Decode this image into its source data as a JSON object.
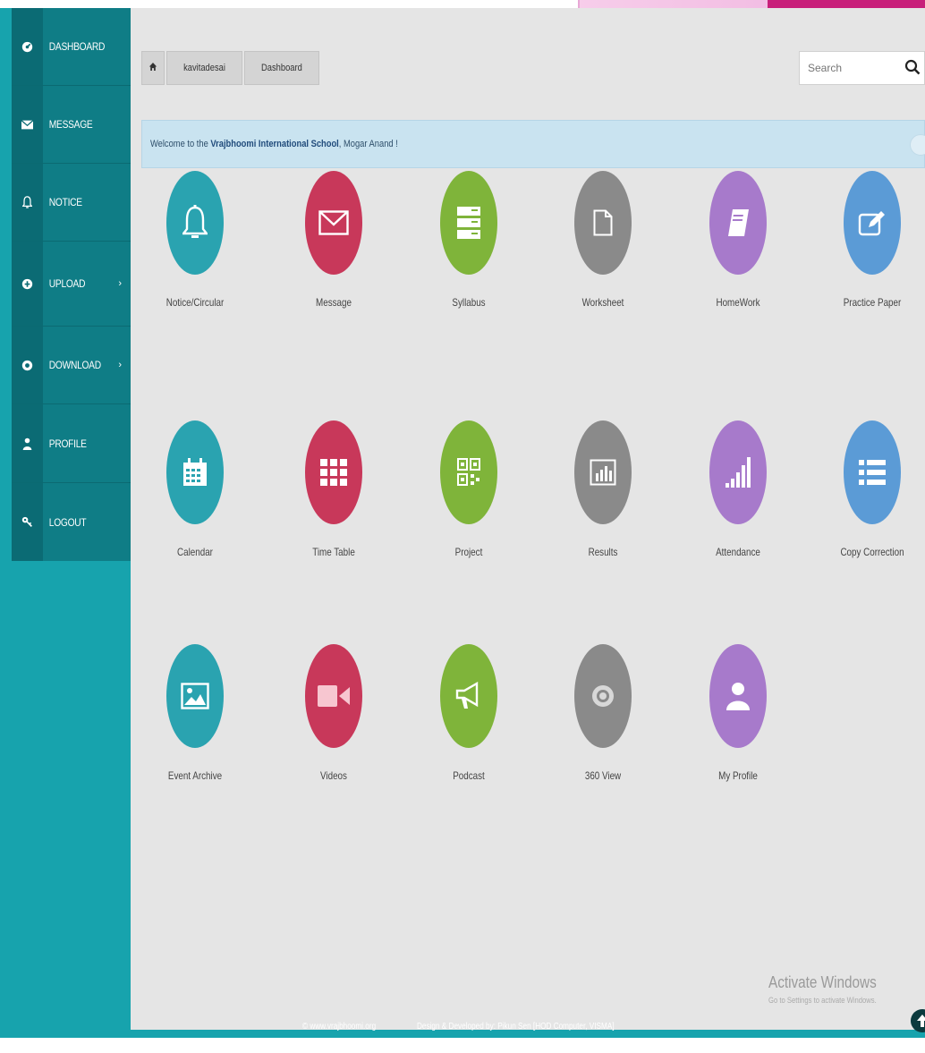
{
  "sidebar": {
    "items": [
      {
        "label": "DASHBOARD",
        "icon": "dashboard-icon"
      },
      {
        "label": "MESSAGE",
        "icon": "envelope-icon"
      },
      {
        "label": "NOTICE",
        "icon": "bell-icon"
      },
      {
        "label": "UPLOAD",
        "icon": "upload-icon",
        "chevron": "›"
      },
      {
        "label": "DOWNLOAD",
        "icon": "download-icon",
        "chevron": "›"
      },
      {
        "label": "PROFILE",
        "icon": "user-icon"
      },
      {
        "label": "LOGOUT",
        "icon": "key-icon"
      }
    ]
  },
  "breadcrumb": {
    "home_icon": "home-icon",
    "items": [
      "kavitadesai",
      "Dashboard"
    ]
  },
  "search": {
    "placeholder": "Search"
  },
  "welcome": {
    "prefix": "Welcome to the ",
    "school": "Vrajbhoomi International School",
    "suffix": ", Mogar Anand !"
  },
  "tiles": [
    {
      "label": "Notice/Circular",
      "color": "#2aa3b0",
      "icon": "bell-icon"
    },
    {
      "label": "Message",
      "color": "#c8385a",
      "icon": "envelope-icon"
    },
    {
      "label": "Syllabus",
      "color": "#7fb43a",
      "icon": "server-icon"
    },
    {
      "label": "Worksheet",
      "color": "#8a8a8a",
      "icon": "file-icon"
    },
    {
      "label": "HomeWork",
      "color": "#a77acb",
      "icon": "book-icon"
    },
    {
      "label": "Practice Paper",
      "color": "#5b9bd6",
      "icon": "edit-icon"
    },
    {
      "label": "Calendar",
      "color": "#2aa3b0",
      "icon": "calendar-icon"
    },
    {
      "label": "Time Table",
      "color": "#c8385a",
      "icon": "grid-icon"
    },
    {
      "label": "Project",
      "color": "#7fb43a",
      "icon": "qr-icon"
    },
    {
      "label": "Results",
      "color": "#8a8a8a",
      "icon": "bar-chart-icon"
    },
    {
      "label": "Attendance",
      "color": "#a77acb",
      "icon": "signal-icon"
    },
    {
      "label": "Copy Correction",
      "color": "#5b9bd6",
      "icon": "list-icon"
    },
    {
      "label": "Event Archive",
      "color": "#2aa3b0",
      "icon": "image-icon"
    },
    {
      "label": "Videos",
      "color": "#c8385a",
      "icon": "video-camera-icon"
    },
    {
      "label": "Podcast",
      "color": "#7fb43a",
      "icon": "megaphone-icon"
    },
    {
      "label": "360 View",
      "color": "#8a8a8a",
      "icon": "eye-icon"
    },
    {
      "label": "My Profile",
      "color": "#a77acb",
      "icon": "user-icon"
    }
  ],
  "footer": {
    "site": "© www.vrajbhoomi.org",
    "credit": "Design & Developed by: Pikun Sen [HOD Computer, VISMA]"
  },
  "watermark": {
    "title": "Activate Windows",
    "subtitle": "Go to Settings to activate Windows."
  },
  "colors": {
    "teal": "#17a3ad",
    "sidebar": "#0f7d86",
    "content_bg": "#e5e5e5"
  }
}
